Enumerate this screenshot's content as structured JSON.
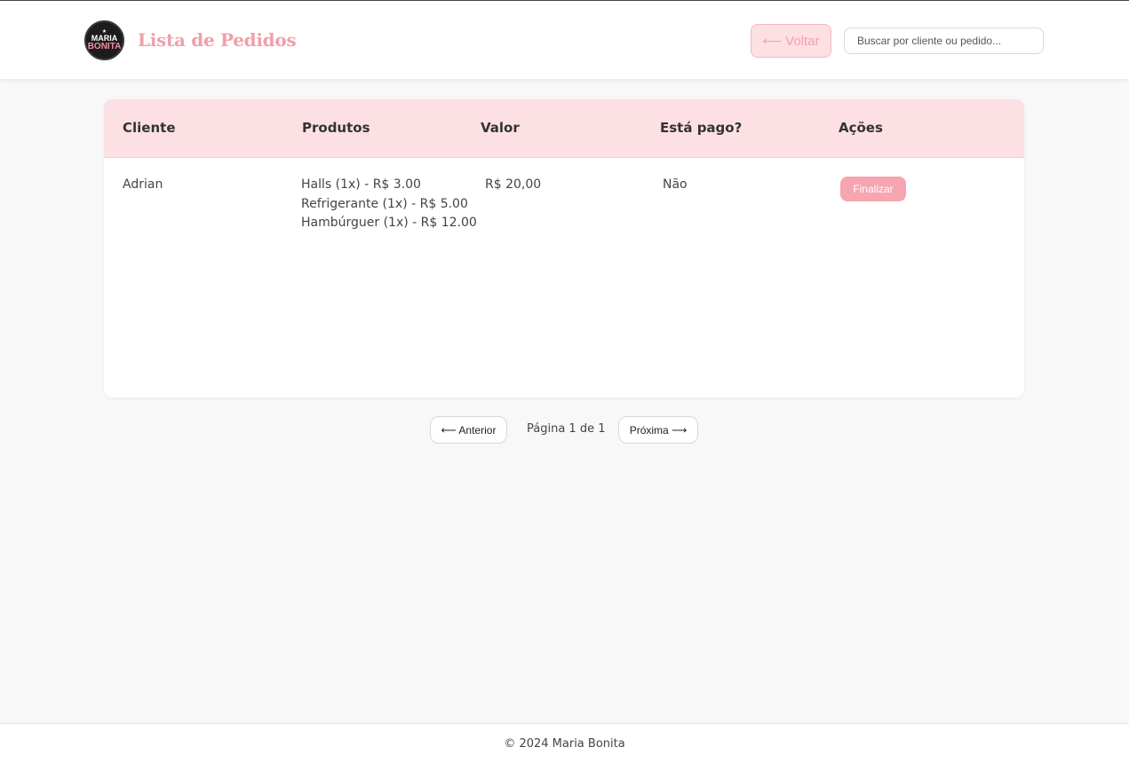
{
  "header": {
    "logo": {
      "line1": "MARIA",
      "line2": "BONITA",
      "icon": "star-icon"
    },
    "title": "Lista de Pedidos",
    "back_label": "⟵ Voltar",
    "search_placeholder": "Buscar por cliente ou pedido..."
  },
  "table": {
    "columns": [
      "Cliente",
      "Produtos",
      "Valor",
      "Está pago?",
      "Ações"
    ],
    "rows": [
      {
        "cliente": "Adrian",
        "produtos": [
          "Halls (1x) - R$ 3.00",
          "Refrigerante (1x) - R$ 5.00",
          "Hambúrguer (1x) - R$ 12.00"
        ],
        "valor": "R$ 20,00",
        "pago": "Não",
        "action_label": "Finalizar"
      }
    ]
  },
  "pagination": {
    "prev_label": "⟵ Anterior",
    "info": "Página 1 de 1",
    "next_label": "Próxima ⟶"
  },
  "footer": {
    "text": "© 2024 Maria Bonita"
  },
  "colors": {
    "accent": "#f0a0ab",
    "header_bg": "#fde0e4",
    "button": "#f6a5b1"
  }
}
